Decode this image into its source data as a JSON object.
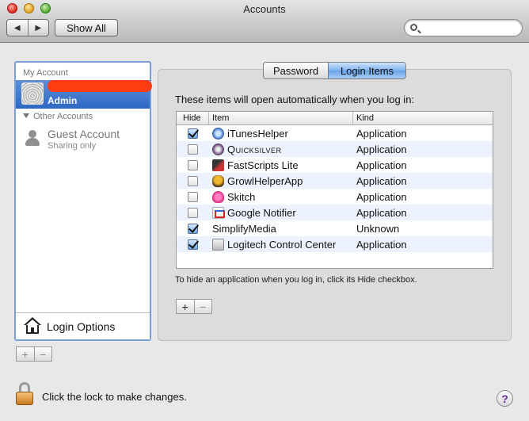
{
  "window": {
    "title": "Accounts"
  },
  "toolbar": {
    "back_icon": "◀",
    "forward_icon": "▶",
    "show_all_label": "Show All",
    "search_placeholder": "",
    "search_value": ""
  },
  "sidebar": {
    "my_account_header": "My Account",
    "current_user_role": "Admin",
    "other_accounts_header": "Other Accounts",
    "guest_name": "Guest Account",
    "guest_status": "Sharing only",
    "login_options_label": "Login Options",
    "add_label": "+",
    "remove_label": "−"
  },
  "tabs": [
    {
      "label": "Password",
      "selected": false
    },
    {
      "label": "Login Items",
      "selected": true
    }
  ],
  "login_items": {
    "heading": "These items will open automatically when you log in:",
    "columns": {
      "hide": "Hide",
      "item": "Item",
      "kind": "Kind"
    },
    "rows": [
      {
        "name": "iTunesHelper",
        "kind": "Application",
        "hide": true,
        "icon": "itunes-icon"
      },
      {
        "name": "Quicksilver",
        "kind": "Application",
        "hide": false,
        "icon": "quicksilver-icon"
      },
      {
        "name": "FastScripts Lite",
        "kind": "Application",
        "hide": false,
        "icon": "fastscripts-icon"
      },
      {
        "name": "GrowlHelperApp",
        "kind": "Application",
        "hide": false,
        "icon": "growl-icon"
      },
      {
        "name": "Skitch",
        "kind": "Application",
        "hide": false,
        "icon": "skitch-icon"
      },
      {
        "name": "Google Notifier",
        "kind": "Application",
        "hide": false,
        "icon": "google-notifier-icon"
      },
      {
        "name": "SimplifyMedia",
        "kind": "Unknown",
        "hide": true,
        "icon": ""
      },
      {
        "name": "Logitech Control Center",
        "kind": "Application",
        "hide": true,
        "icon": "logitech-icon"
      }
    ],
    "hint": "To hide an application when you log in, click its Hide checkbox.",
    "add_label": "+",
    "remove_label": "−"
  },
  "footer": {
    "lock_text": "Click the lock to make changes.",
    "help_label": "?"
  },
  "colors": {
    "selection": "#3a74cc",
    "redaction": "#ff3b12",
    "help_accent": "#6b2fa8"
  }
}
